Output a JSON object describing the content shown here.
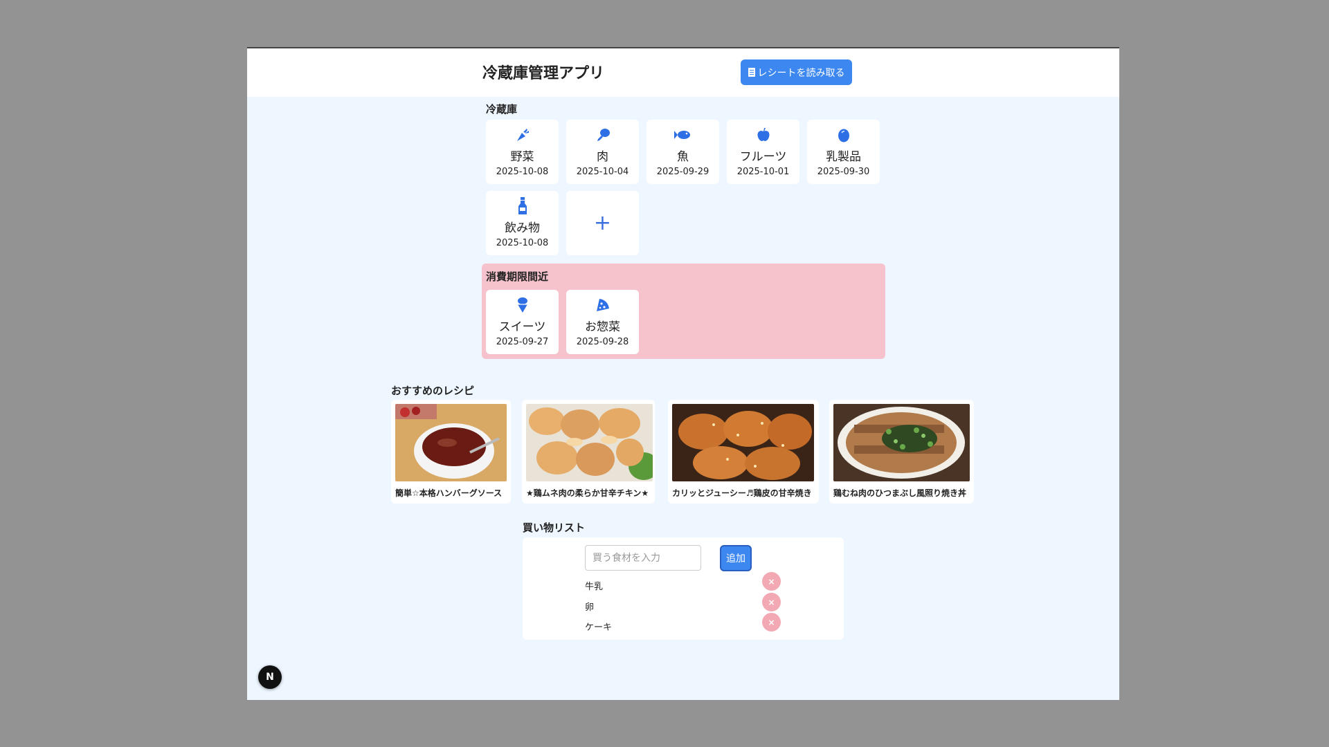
{
  "header": {
    "title": "冷蔵庫管理アプリ",
    "receipt_button": "レシートを読み取る"
  },
  "fridge": {
    "label": "冷蔵庫",
    "items": [
      {
        "name": "野菜",
        "date": "2025-10-08",
        "icon": "carrot-icon"
      },
      {
        "name": "肉",
        "date": "2025-10-04",
        "icon": "drumstick-icon"
      },
      {
        "name": "魚",
        "date": "2025-09-29",
        "icon": "fish-icon"
      },
      {
        "name": "フルーツ",
        "date": "2025-10-01",
        "icon": "apple-icon"
      },
      {
        "name": "乳製品",
        "date": "2025-09-30",
        "icon": "egg-icon"
      },
      {
        "name": "飲み物",
        "date": "2025-10-08",
        "icon": "bottle-icon"
      }
    ],
    "add_label": "+"
  },
  "expiring": {
    "label": "消費期限間近",
    "items": [
      {
        "name": "スイーツ",
        "date": "2025-09-27",
        "icon": "ice-cream-icon"
      },
      {
        "name": "お惣菜",
        "date": "2025-09-28",
        "icon": "pizza-icon"
      }
    ]
  },
  "recipes": {
    "label": "おすすめのレシピ",
    "items": [
      {
        "title": "簡単☆本格ハンバーグソース"
      },
      {
        "title": "★鶏ムネ肉の柔らか甘辛チキン★"
      },
      {
        "title": "カリッとジューシー♬鶏皮の甘辛焼き"
      },
      {
        "title": "鶏むね肉のひつまぶし風照り焼き丼"
      }
    ]
  },
  "shopping": {
    "label": "買い物リスト",
    "placeholder": "買う食材を入力",
    "add_button": "追加",
    "items": [
      "牛乳",
      "卵",
      "ケーキ"
    ],
    "delete_symbol": "×"
  },
  "badge": "N",
  "colors": {
    "accent": "#3c87f0",
    "icon": "#2f6fe6",
    "background": "#eef6ff",
    "expiring_bg": "#f6c2cb",
    "delete_button": "#f3a9b4"
  }
}
